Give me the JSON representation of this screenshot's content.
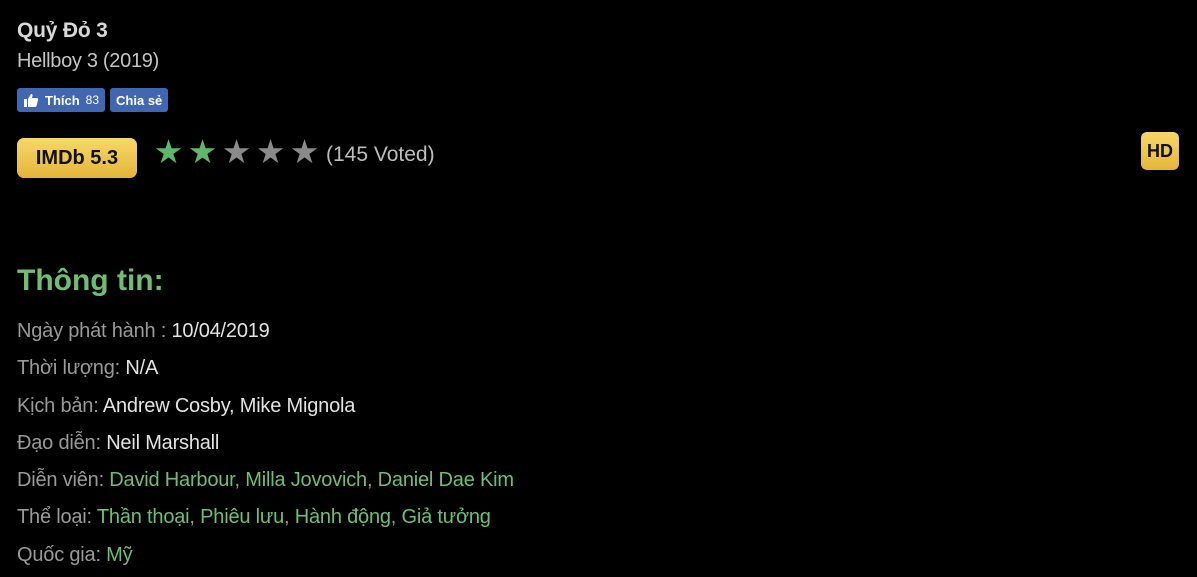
{
  "movie": {
    "title": "Quỷ Đỏ 3",
    "original_title": "Hellboy 3 (2019)"
  },
  "social": {
    "like_label": "Thích",
    "like_count": "83",
    "share_label": "Chia sẻ",
    "color": "#4267b2"
  },
  "rating": {
    "imdb_label": "IMDb 5.3",
    "stars_filled": 2,
    "stars_total": 5,
    "votes_text": "(145 Voted)",
    "star_on_color": "#5fb86a",
    "star_off_color": "#8a8a8a"
  },
  "quality_badge": "HD",
  "info": {
    "heading": "Thông tin:",
    "release": {
      "label": "Ngày phát hành : ",
      "value": "10/04/2019"
    },
    "duration": {
      "label": "Thời lượng: ",
      "value": "N/A"
    },
    "writers": {
      "label": "Kịch bản: ",
      "value": "Andrew Cosby, Mike Mignola"
    },
    "director": {
      "label": "Đạo diễn: ",
      "value": "Neil Marshall"
    },
    "cast": {
      "label": "Diễn viên: ",
      "items": [
        "David Harbour",
        "Milla Jovovich",
        "Daniel Dae Kim"
      ]
    },
    "genres": {
      "label": "Thể loại: ",
      "items": [
        "Thần thoại",
        "Phiêu lưu",
        "Hành động",
        "Giả tưởng"
      ]
    },
    "country": {
      "label": "Quốc gia: ",
      "items": [
        "Mỹ"
      ]
    }
  },
  "colors": {
    "accent_green": "#6fbf73",
    "badge_gold": "#f0c850",
    "background": "#000000"
  }
}
